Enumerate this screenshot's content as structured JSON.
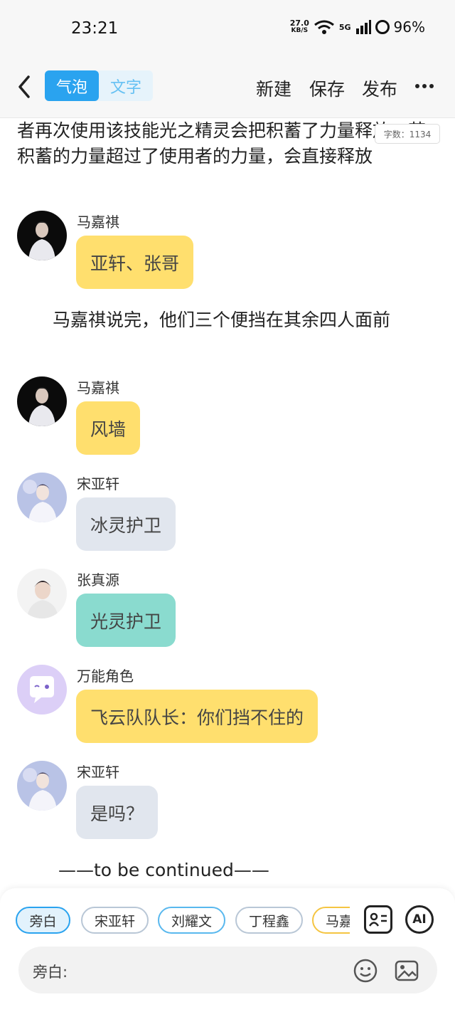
{
  "status": {
    "time": "23:21",
    "net_speed_value": "27.0",
    "net_speed_unit": "KB/S",
    "signal": "5G",
    "battery": "96%"
  },
  "header": {
    "toggle": [
      "气泡",
      "文字"
    ],
    "actions": [
      "新建",
      "保存",
      "发布"
    ]
  },
  "story": {
    "top_text": "者再次使用该技能光之精灵会把积蓄了力量释放，若积蓄的力量超过了使用者的力量，会直接释放",
    "word_count": "字数：1134",
    "messages": [
      {
        "name": "马嘉祺",
        "text": "亚轩、张哥",
        "color": "yellow",
        "avatar": "dark-portrait"
      },
      {
        "name": "马嘉祺",
        "text": "风墙",
        "color": "yellow",
        "avatar": "dark-portrait"
      },
      {
        "name": "宋亚轩",
        "text": "冰灵护卫",
        "color": "gray",
        "avatar": "light-portrait"
      },
      {
        "name": "张真源",
        "text": "光灵护卫",
        "color": "teal",
        "avatar": "white-portrait"
      },
      {
        "name": "万能角色",
        "text": "飞云队队长：你们挡不住的",
        "color": "yellow",
        "avatar": "chat-bubble-icon"
      },
      {
        "name": "宋亚轩",
        "text": "是吗？",
        "color": "gray",
        "avatar": "light-portrait"
      }
    ],
    "narration_1": "　　马嘉祺说完，他们三个便挡在其余四人面前",
    "ending": "——to be continued——"
  },
  "bottom": {
    "chips": [
      "旁白",
      "宋亚轩",
      "刘耀文",
      "丁程鑫",
      "马嘉祺"
    ],
    "ai_label": "AI",
    "input_label": "旁白:"
  },
  "colors": {
    "accent": "#2aa3ef",
    "yellow": "#ffdf6e",
    "gray": "#e1e6ee",
    "teal": "#8adbcf"
  }
}
